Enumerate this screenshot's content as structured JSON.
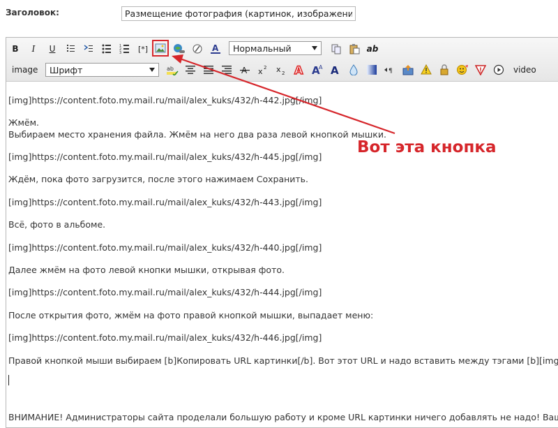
{
  "header": {
    "label": "Заголовок:",
    "title_value": "Размещение фотография (картинок, изображений) на"
  },
  "toolbar": {
    "row1": {
      "bold": "B",
      "italic": "I",
      "underline": "U",
      "code": "[*]",
      "format_select": "Нормальный",
      "ab": "ab"
    },
    "row2": {
      "image_label": "image",
      "font_select": "Шрифт",
      "video_label": "video"
    }
  },
  "content_lines": [
    "[img]https://content.foto.my.mail.ru/mail/alex_kuks/432/h-442.jpg[/img]",
    "",
    "Жмём.",
    "Выбираем место хранения файла. Жмём на него два раза левой кнопкой мышки.",
    "",
    "[img]https://content.foto.my.mail.ru/mail/alex_kuks/432/h-445.jpg[/img]",
    "",
    "Ждём, пока фото загрузится, после этого нажимаем Сохранить.",
    "",
    "[img]https://content.foto.my.mail.ru/mail/alex_kuks/432/h-443.jpg[/img]",
    "",
    "Всё, фото в альбоме.",
    "",
    "[img]https://content.foto.my.mail.ru/mail/alex_kuks/432/h-440.jpg[/img]",
    "",
    "Далее жмём на фото левой кнопки мышки, открывая фото.",
    "",
    "[img]https://content.foto.my.mail.ru/mail/alex_kuks/432/h-444.jpg[/img]",
    "",
    "После открытия фото, жмём на фото правой кнопкой мышки, выпадает меню:",
    "",
    "[img]https://content.foto.my.mail.ru/mail/alex_kuks/432/h-446.jpg[/img]",
    "",
    "Правой кнопкой мыши выбираем [b]Копировать URL картинки[/b]. Вот этот URL и надо вставить между тэгами [b][img][/b] и [",
    "",
    "",
    "",
    "",
    "ВНИМАНИЕ! Администраторы сайта проделали большую работу и кроме URL картинки ничего добавлять не надо! Ваша фотогр"
  ],
  "annotation": {
    "text": "Вот эта кнопка",
    "color": "#d6262b"
  }
}
